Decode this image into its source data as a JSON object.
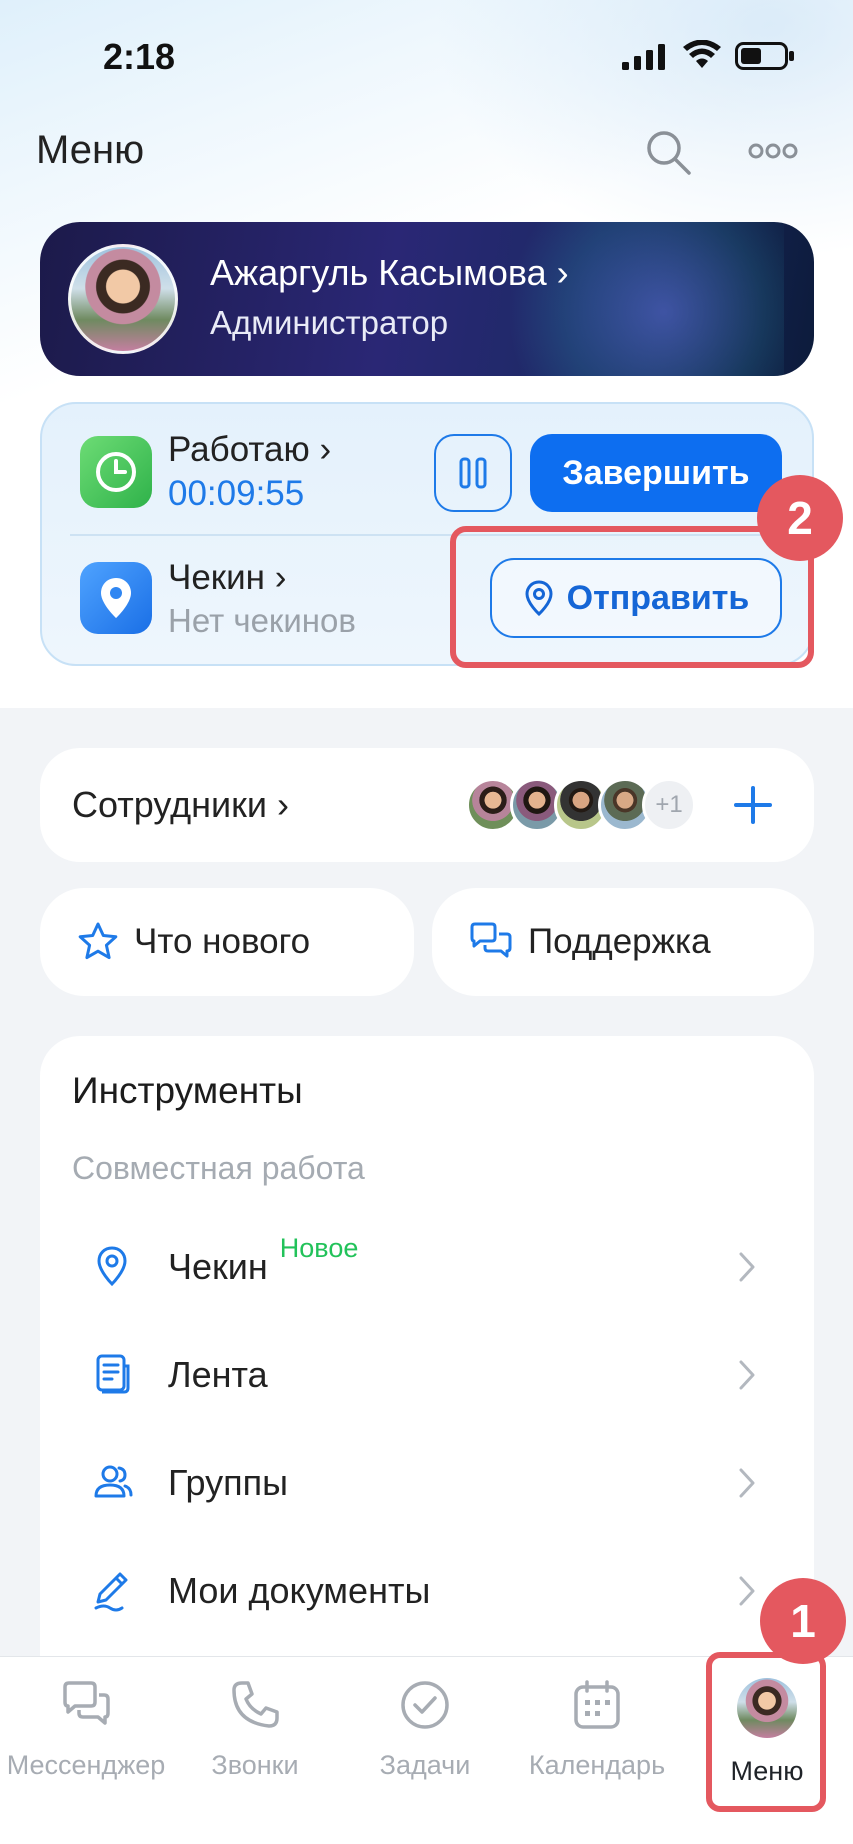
{
  "status_bar": {
    "time": "2:18"
  },
  "header": {
    "title": "Меню"
  },
  "profile": {
    "name": "Ажаргуль Касымова ›",
    "role": "Администратор"
  },
  "work": {
    "status_label": "Работаю ›",
    "timer": "00:09:55",
    "finish_label": "Завершить",
    "checkin_label": "Чекин ›",
    "checkin_sub": "Нет чекинов",
    "send_label": "Отправить"
  },
  "annotations": {
    "badge_2": "2",
    "badge_1": "1"
  },
  "employees": {
    "label": "Сотрудники ›",
    "more_count": "+1"
  },
  "quick": {
    "whats_new": "Что нового",
    "support": "Поддержка"
  },
  "tools": {
    "title": "Инструменты",
    "subtitle": "Совместная работа",
    "items": [
      {
        "label": "Чекин",
        "tag": "Новое",
        "icon": "location-pin-icon"
      },
      {
        "label": "Лента",
        "tag": "",
        "icon": "feed-icon"
      },
      {
        "label": "Группы",
        "tag": "",
        "icon": "groups-icon"
      },
      {
        "label": "Мои документы",
        "tag": "",
        "icon": "pen-icon"
      }
    ]
  },
  "tabbar": {
    "items": [
      {
        "label": "Мессенджер",
        "icon": "chat-icon"
      },
      {
        "label": "Звонки",
        "icon": "phone-icon"
      },
      {
        "label": "Задачи",
        "icon": "check-circle-icon"
      },
      {
        "label": "Календарь",
        "icon": "calendar-icon"
      },
      {
        "label": "Меню",
        "icon": "avatar"
      }
    ],
    "active_index": 4
  },
  "colors": {
    "accent": "#0d6ef0",
    "highlight": "#e4585f",
    "new_tag": "#22c25a"
  }
}
